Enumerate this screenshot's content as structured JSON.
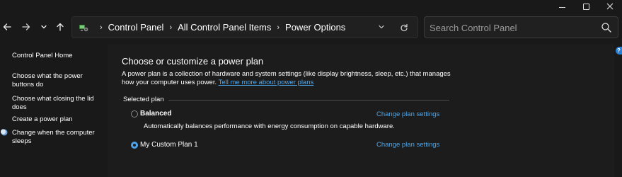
{
  "window": {
    "caption_buttons": [
      "minimize",
      "maximize",
      "close"
    ]
  },
  "nav": {
    "back_icon": "arrow-left-icon",
    "forward_icon": "arrow-right-icon",
    "recent_icon": "chevron-down-icon",
    "up_icon": "arrow-up-icon"
  },
  "address": {
    "icon": "control-panel-icon",
    "crumbs": [
      "Control Panel",
      "All Control Panel Items",
      "Power Options"
    ]
  },
  "search": {
    "placeholder": "Search Control Panel"
  },
  "sidebar": {
    "items": [
      {
        "label": "Control Panel Home"
      },
      {
        "label": "Choose what the power buttons do"
      },
      {
        "label": "Choose what closing the lid does"
      },
      {
        "label": "Create a power plan"
      },
      {
        "label": "Change when the computer sleeps"
      }
    ]
  },
  "main": {
    "title": "Choose or customize a power plan",
    "description": "A power plan is a collection of hardware and system settings (like display brightness, sleep, etc.) that manages how your computer uses power.",
    "learn_more": "Tell me more about power plans",
    "group_label": "Selected plan",
    "plans": [
      {
        "name": "Balanced",
        "selected": false,
        "description": "Automatically balances performance with energy consumption on capable hardware.",
        "change_link": "Change plan settings"
      },
      {
        "name": "My Custom Plan 1",
        "selected": true,
        "change_link": "Change plan settings"
      }
    ]
  },
  "colors": {
    "accent": "#4ca3ec",
    "link": "#4ea6ea",
    "background": "#191919",
    "content_background": "#1c1c1c"
  }
}
